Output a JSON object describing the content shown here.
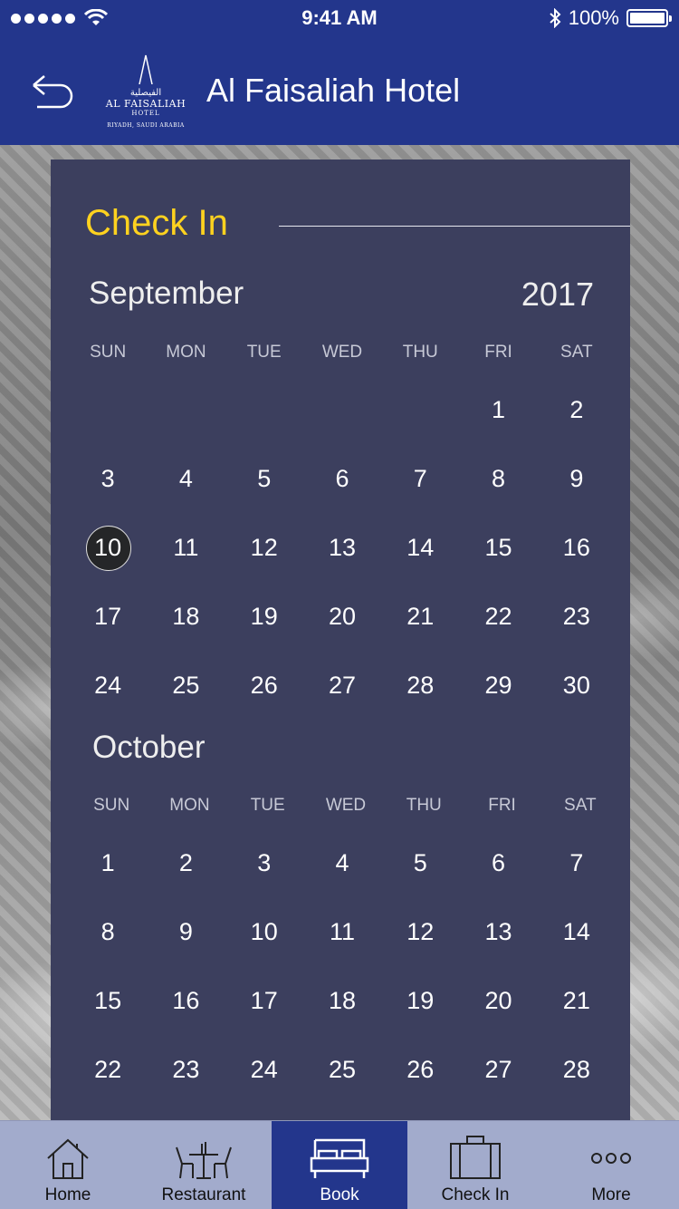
{
  "status_bar": {
    "time": "9:41 AM",
    "battery_text": "100%",
    "battery_level": 1.0
  },
  "header": {
    "title": "Al Faisaliah Hotel",
    "logo": {
      "arabic": "الفيصلية",
      "name": "AL FAISALIAH",
      "sub": "HOTEL",
      "location": "RIYADH, SAUDI ARABIA"
    }
  },
  "calendar": {
    "heading": "Check In",
    "year": "2017",
    "weekdays": [
      "SUN",
      "MON",
      "TUE",
      "WED",
      "THU",
      "FRI",
      "SAT"
    ],
    "selected_day": "10",
    "months": [
      {
        "name": "September",
        "weeks": [
          [
            "",
            "",
            "",
            "",
            "",
            "1",
            "2"
          ],
          [
            "3",
            "4",
            "5",
            "6",
            "7",
            "8",
            "9"
          ],
          [
            "10",
            "11",
            "12",
            "13",
            "14",
            "15",
            "16"
          ],
          [
            "17",
            "18",
            "19",
            "20",
            "21",
            "22",
            "23"
          ],
          [
            "24",
            "25",
            "26",
            "27",
            "28",
            "29",
            "30"
          ]
        ]
      },
      {
        "name": "October",
        "weeks": [
          [
            "1",
            "2",
            "3",
            "4",
            "5",
            "6",
            "7"
          ],
          [
            "8",
            "9",
            "10",
            "11",
            "12",
            "13",
            "14"
          ],
          [
            "15",
            "16",
            "17",
            "18",
            "19",
            "20",
            "21"
          ],
          [
            "22",
            "23",
            "24",
            "25",
            "26",
            "27",
            "28"
          ]
        ]
      }
    ]
  },
  "tabs": [
    {
      "label": "Home",
      "icon": "home-icon",
      "active": false
    },
    {
      "label": "Restaurant",
      "icon": "restaurant-icon",
      "active": false
    },
    {
      "label": "Book",
      "icon": "bed-icon",
      "active": true
    },
    {
      "label": "Check In",
      "icon": "suitcase-icon",
      "active": false
    },
    {
      "label": "More",
      "icon": "more-icon",
      "active": false
    }
  ],
  "colors": {
    "header": "#23368c",
    "panel": "#3c3f5e",
    "heading_accent": "#ffd21f",
    "tab_bar": "#a2abcc",
    "tab_active": "#23368c"
  }
}
